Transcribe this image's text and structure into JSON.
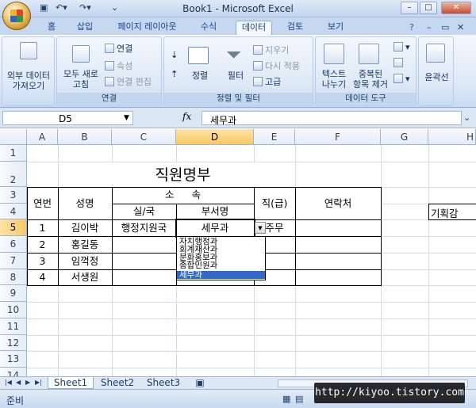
{
  "window": {
    "title": "Book1 - Microsoft Excel"
  },
  "ribbon_tabs": [
    "홈",
    "삽입",
    "페이지 레이아웃",
    "수식",
    "데이터",
    "검토",
    "보기"
  ],
  "ribbon": {
    "external_data": {
      "label1": "외부 데이터",
      "label2": "가져오기"
    },
    "connections": {
      "refresh1": "모두 새로",
      "refresh2": "고침",
      "connections": "연결",
      "properties": "속성",
      "edit_links": "연결 편집",
      "group": "연결"
    },
    "sort_filter": {
      "sort": "정렬",
      "filter": "필터",
      "clear": "지우기",
      "reapply": "다시 적용",
      "advanced": "고급",
      "group": "정렬 및 필터"
    },
    "data_tools": {
      "text_to_cols1": "텍스트",
      "text_to_cols2": "나누기",
      "remove_dup1": "중복된",
      "remove_dup2": "항목 제거",
      "group": "데이터 도구"
    },
    "outline": {
      "label": "윤곽선"
    }
  },
  "formula_bar": {
    "name_box": "D5",
    "fx": "fx",
    "value": "세무과"
  },
  "columns": [
    "A",
    "B",
    "C",
    "D",
    "E",
    "F",
    "G",
    "H"
  ],
  "rows": [
    "1",
    "2",
    "3",
    "4",
    "5",
    "6",
    "7",
    "8",
    "9",
    "10",
    "11",
    "12",
    "13",
    "14"
  ],
  "sheet": {
    "title": "직원명부",
    "hdr_no": "연번",
    "hdr_name": "성명",
    "hdr_dept": "소 속",
    "hdr_office": "실/국",
    "hdr_division": "부서명",
    "hdr_rank": "직(급)",
    "hdr_contact": "연락처",
    "h4": "기획감",
    "rows": [
      {
        "no": "1",
        "name": "김이박",
        "office": "행정지원국",
        "division": "세무과",
        "rank": "주무"
      },
      {
        "no": "2",
        "name": "홍길동"
      },
      {
        "no": "3",
        "name": "임꺽정"
      },
      {
        "no": "4",
        "name": "서생원"
      }
    ]
  },
  "dropdown": {
    "items": [
      "자치행정과",
      "회계재산과",
      "문화홍보과",
      "종합민원과",
      "세무과"
    ],
    "selected": 4
  },
  "sheet_tabs": [
    "Sheet1",
    "Sheet2",
    "Sheet3"
  ],
  "status": {
    "text": "준비"
  },
  "watermark": "http://kiyoo.tistory.com"
}
